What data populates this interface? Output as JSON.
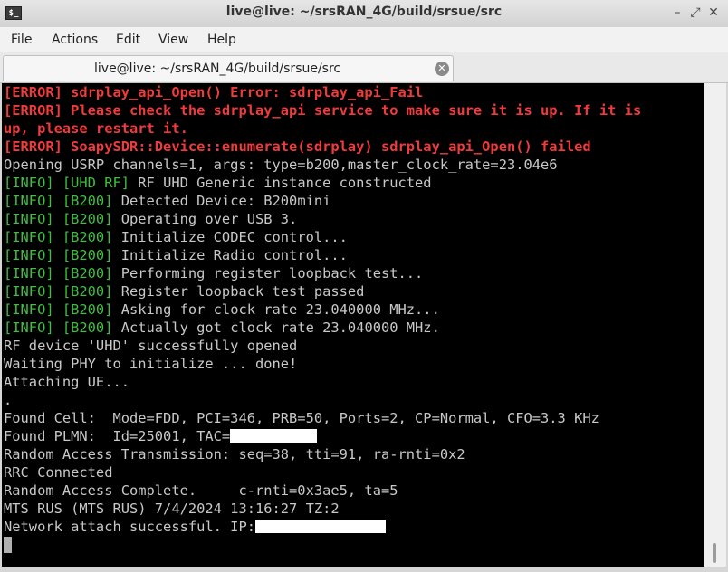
{
  "window": {
    "title": "live@live: ~/srsRAN_4G/build/srsue/src",
    "icon_glyph": "$_",
    "buttons": [
      "–",
      "⤢",
      "✕"
    ]
  },
  "menubar": {
    "items": [
      "File",
      "Actions",
      "Edit",
      "View",
      "Help"
    ]
  },
  "tab": {
    "label": "live@live: ~/srsRAN_4G/build/srsue/src",
    "close_glyph": "✕"
  },
  "colors": {
    "error": "#ef3b3b",
    "info_tag": "#3fbf3f",
    "text": "#c8c8c8",
    "background": "#000000"
  },
  "terminal": {
    "lines": [
      {
        "parts": [
          {
            "t": "[ERROR] sdrplay_api_Open() Error: sdrplay_api_Fail",
            "c": "err"
          }
        ]
      },
      {
        "parts": [
          {
            "t": "[ERROR] Please check the sdrplay_api service to make sure it is up. If it is",
            "c": "err"
          }
        ]
      },
      {
        "parts": [
          {
            "t": "up, please restart it.",
            "c": "err"
          }
        ]
      },
      {
        "parts": [
          {
            "t": "[ERROR] SoapySDR::Device::enumerate(sdrplay) sdrplay_api_Open() failed",
            "c": "err"
          }
        ]
      },
      {
        "parts": [
          {
            "t": "Opening USRP channels=1, args: type=b200,master_clock_rate=23.04e6"
          }
        ]
      },
      {
        "parts": [
          {
            "t": "[INFO] [UHD RF]",
            "c": "tag"
          },
          {
            "t": " RF UHD Generic instance constructed"
          }
        ]
      },
      {
        "parts": [
          {
            "t": "[INFO] [B200]",
            "c": "tag"
          },
          {
            "t": " Detected Device: B200mini"
          }
        ]
      },
      {
        "parts": [
          {
            "t": "[INFO] [B200]",
            "c": "tag"
          },
          {
            "t": " Operating over USB 3."
          }
        ]
      },
      {
        "parts": [
          {
            "t": "[INFO] [B200]",
            "c": "tag"
          },
          {
            "t": " Initialize CODEC control..."
          }
        ]
      },
      {
        "parts": [
          {
            "t": "[INFO] [B200]",
            "c": "tag"
          },
          {
            "t": " Initialize Radio control..."
          }
        ]
      },
      {
        "parts": [
          {
            "t": "[INFO] [B200]",
            "c": "tag"
          },
          {
            "t": " Performing register loopback test..."
          }
        ]
      },
      {
        "parts": [
          {
            "t": "[INFO] [B200]",
            "c": "tag"
          },
          {
            "t": " Register loopback test passed"
          }
        ]
      },
      {
        "parts": [
          {
            "t": "[INFO] [B200]",
            "c": "tag"
          },
          {
            "t": " Asking for clock rate 23.040000 MHz..."
          }
        ]
      },
      {
        "parts": [
          {
            "t": "[INFO] [B200]",
            "c": "tag"
          },
          {
            "t": " Actually got clock rate 23.040000 MHz."
          }
        ]
      },
      {
        "parts": [
          {
            "t": "RF device 'UHD' successfully opened"
          }
        ]
      },
      {
        "parts": [
          {
            "t": "Waiting PHY to initialize ... done!"
          }
        ]
      },
      {
        "parts": [
          {
            "t": "Attaching UE..."
          }
        ]
      },
      {
        "parts": [
          {
            "t": "."
          }
        ]
      },
      {
        "parts": [
          {
            "t": "Found Cell:  Mode=FDD, PCI=346, PRB=50, Ports=2, CP=Normal, CFO=3.3 KHz"
          }
        ]
      },
      {
        "parts": [
          {
            "t": "Found PLMN:  Id=25001, TAC="
          },
          {
            "redact": 96
          }
        ]
      },
      {
        "parts": [
          {
            "t": "Random Access Transmission: seq=38, tti=91, ra-rnti=0x2"
          }
        ]
      },
      {
        "parts": [
          {
            "t": "RRC Connected"
          }
        ]
      },
      {
        "parts": [
          {
            "t": "Random Access Complete.     c-rnti=0x3ae5, ta=5"
          }
        ]
      },
      {
        "parts": [
          {
            "t": "MTS RUS (MTS RUS) 7/4/2024 13:16:27 TZ:2"
          }
        ]
      },
      {
        "parts": [
          {
            "t": "Network attach successful. IP:"
          },
          {
            "redact": 144
          }
        ]
      },
      {
        "parts": [
          {
            "cursor": true
          }
        ]
      }
    ]
  }
}
